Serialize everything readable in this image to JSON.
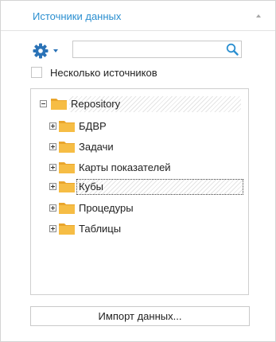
{
  "panel": {
    "title": "Источники данных"
  },
  "toolbar": {
    "settings_icon": "gear-icon",
    "search_placeholder": "",
    "search_value": "",
    "search_icon": "search-icon"
  },
  "options": {
    "multi_source_label": "Несколько источников",
    "multi_source_checked": false
  },
  "tree": {
    "root": {
      "label": "Repository",
      "expanded": true
    },
    "items": [
      {
        "label": "БДВР",
        "expanded": false
      },
      {
        "label": "Задачи",
        "expanded": false
      },
      {
        "label": "Карты показателей",
        "expanded": false
      },
      {
        "label": "Кубы",
        "expanded": false,
        "focused": true
      },
      {
        "label": "Процедуры",
        "expanded": false
      },
      {
        "label": "Таблицы",
        "expanded": false
      }
    ]
  },
  "footer": {
    "import_label": "Импорт данных..."
  },
  "colors": {
    "accent": "#2b8fd0",
    "folder": "#f3b23a",
    "gear": "#2b73b7"
  }
}
